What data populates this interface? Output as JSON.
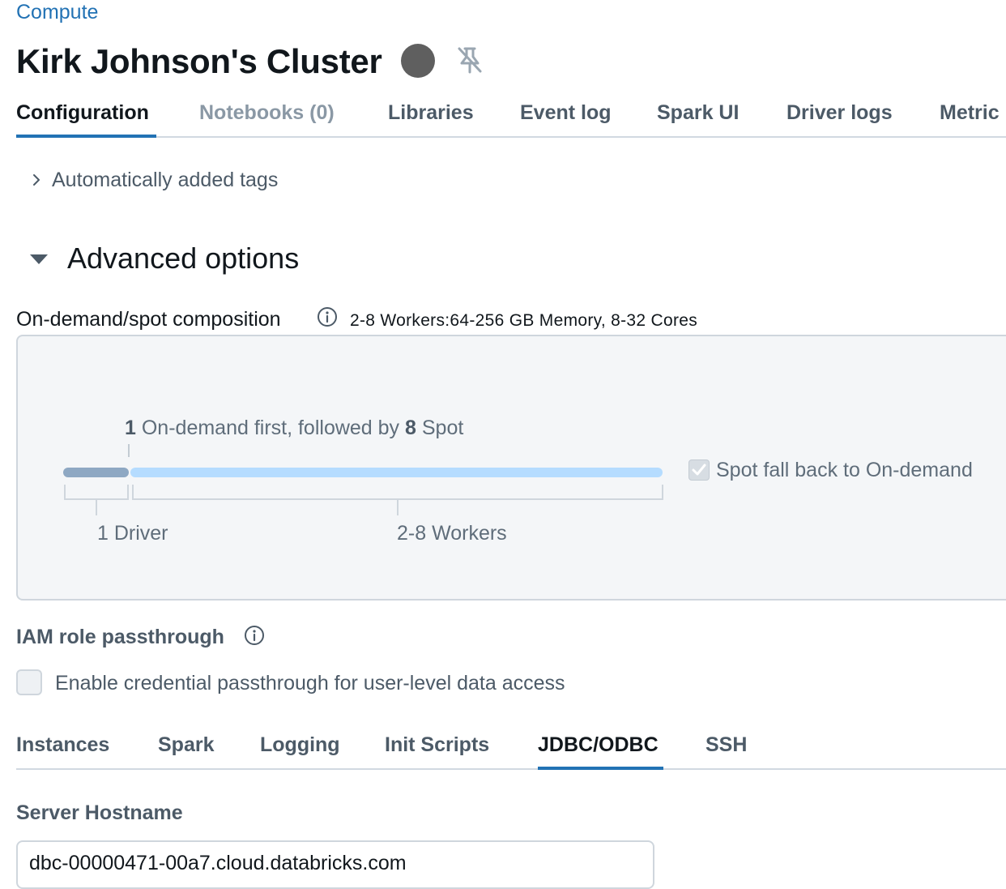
{
  "breadcrumb": {
    "label": "Compute"
  },
  "header": {
    "title": "Kirk Johnson's Cluster",
    "status_color": "#5f5f5f",
    "status_icon": "status-dot",
    "pin_icon": "pin-off-icon"
  },
  "tabs": [
    {
      "label": "Configuration"
    },
    {
      "label": "Notebooks (0)"
    },
    {
      "label": "Libraries"
    },
    {
      "label": "Event log"
    },
    {
      "label": "Spark UI"
    },
    {
      "label": "Driver logs"
    },
    {
      "label": "Metric"
    }
  ],
  "auto_tags": {
    "label": "Automatically added tags"
  },
  "advanced": {
    "title": "Advanced options"
  },
  "composition": {
    "label": "On-demand/spot composition",
    "summary": "2-8 Workers:64-256 GB Memory, 8-32 Cores",
    "on_demand_count": "1",
    "caption_mid": "On-demand first, followed by",
    "spot_count": "8",
    "caption_end": "Spot",
    "driver_label": "1 Driver",
    "workers_label": "2-8 Workers",
    "spot_fallback_label": "Spot fall back to On-demand",
    "spot_fallback_checked": true,
    "on_demand_fraction": 0.11,
    "colors": {
      "on_demand": "#8ea8c3",
      "spot": "#b5dcff"
    }
  },
  "iam": {
    "label": "IAM role passthrough",
    "credential_label": "Enable credential passthrough for user-level data access"
  },
  "sub_tabs": [
    {
      "label": "Instances"
    },
    {
      "label": "Spark"
    },
    {
      "label": "Logging"
    },
    {
      "label": "Init Scripts"
    },
    {
      "label": "JDBC/ODBC"
    },
    {
      "label": "SSH"
    }
  ],
  "jdbc": {
    "server_hostname_label": "Server Hostname",
    "server_hostname_value": "dbc-00000471-00a7.cloud.databricks.com"
  },
  "colors": {
    "accent": "#2272b4"
  }
}
